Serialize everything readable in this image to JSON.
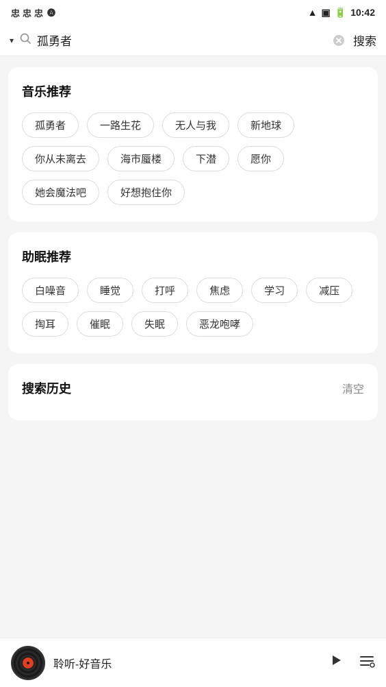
{
  "statusBar": {
    "icons": [
      "忠",
      "忠",
      "忠"
    ],
    "appIcon": "A",
    "time": "10:42"
  },
  "searchBar": {
    "inputValue": "孤勇者",
    "searchLabel": "搜索"
  },
  "musicSection": {
    "title": "音乐推荐",
    "tags": [
      "孤勇者",
      "一路生花",
      "无人与我",
      "新地球",
      "你从未离去",
      "海市蜃楼",
      "下潜",
      "愿你",
      "她会魔法吧",
      "好想抱住你"
    ]
  },
  "sleepSection": {
    "title": "助眠推荐",
    "tags": [
      "白噪音",
      "睡觉",
      "打呼",
      "焦虑",
      "学习",
      "减压",
      "掏耳",
      "催眠",
      "失眠",
      "恶龙咆哮"
    ]
  },
  "historySection": {
    "title": "搜索历史",
    "clearLabel": "清空"
  },
  "playerBar": {
    "songTitle": "聆听-好音乐"
  }
}
